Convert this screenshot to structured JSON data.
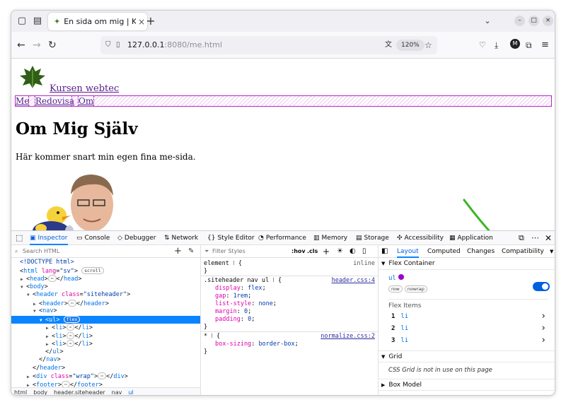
{
  "browser": {
    "tab_title": "En sida om mig | Kursen w",
    "url_host": "127.0.0.1",
    "url_rest": ":8080/me.html",
    "zoom": "120%"
  },
  "page": {
    "site_link": "Kursen webtec",
    "nav": [
      "Me",
      "Redovisa",
      "Om"
    ],
    "heading": "Om Mig Själv",
    "paragraph": "Här kommer snart min egen fina me-sida."
  },
  "devtools": {
    "tabs": [
      "Inspector",
      "Console",
      "Debugger",
      "Network",
      "Style Editor",
      "Performance",
      "Memory",
      "Storage",
      "Accessibility",
      "Application"
    ],
    "markup": {
      "search_placeholder": "Search HTML",
      "lines": [
        {
          "indent": 0,
          "html": "<span class='val'>&lt;!DOCTYPE html&gt;</span>"
        },
        {
          "indent": 0,
          "html": "&lt;<span class='tag'>html</span> <span class='att'>lang</span>=<span class='val'>\"sv\"</span>&gt; <span class='badge'>scroll</span>"
        },
        {
          "indent": 1,
          "tri": "▶",
          "html": "&lt;<span class='tag'>head</span>&gt;<span class='badge'>⋯</span>&lt;/<span class='tag'>head</span>&gt;"
        },
        {
          "indent": 1,
          "tri": "▼",
          "html": "&lt;<span class='tag'>body</span>&gt;"
        },
        {
          "indent": 2,
          "tri": "▼",
          "html": "&lt;<span class='tag'>header</span> <span class='att'>class</span>=<span class='val'>\"siteheader\"</span>&gt;"
        },
        {
          "indent": 3,
          "tri": "▶",
          "html": "&lt;<span class='tag'>header</span>&gt;<span class='badge'>⋯</span>&lt;/<span class='tag'>header</span>&gt;"
        },
        {
          "indent": 3,
          "tri": "▼",
          "html": "&lt;<span class='tag'>nav</span>&gt;"
        },
        {
          "indent": 4,
          "tri": "▼",
          "sel": true,
          "html": "&lt;<span class='tag'>ul</span>&gt; <span class='badge'>flex</span>"
        },
        {
          "indent": 5,
          "tri": "▶",
          "html": "&lt;<span class='tag'>li</span>&gt;<span class='badge'>⋯</span>&lt;/<span class='tag'>li</span>&gt;"
        },
        {
          "indent": 5,
          "tri": "▶",
          "html": "&lt;<span class='tag'>li</span>&gt;<span class='badge'>⋯</span>&lt;/<span class='tag'>li</span>&gt;"
        },
        {
          "indent": 5,
          "tri": "▶",
          "html": "&lt;<span class='tag'>li</span>&gt;<span class='badge'>⋯</span>&lt;/<span class='tag'>li</span>&gt;"
        },
        {
          "indent": 4,
          "html": "&lt;/<span class='tag'>ul</span>&gt;"
        },
        {
          "indent": 3,
          "html": "&lt;/<span class='tag'>nav</span>&gt;"
        },
        {
          "indent": 2,
          "html": "&lt;/<span class='tag'>header</span>&gt;"
        },
        {
          "indent": 2,
          "tri": "▶",
          "html": "&lt;<span class='tag'>div</span> <span class='att'>class</span>=<span class='val'>\"wrap\"</span>&gt;<span class='badge'>⋯</span>&lt;/<span class='tag'>div</span>&gt;"
        },
        {
          "indent": 2,
          "tri": "▶",
          "html": "&lt;<span class='tag'>footer</span>&gt;<span class='badge'>⋯</span>&lt;/<span class='tag'>footer</span>&gt;"
        }
      ],
      "breadcrumbs": [
        "html",
        "body",
        "header.siteheader",
        "nav",
        "ul"
      ]
    },
    "rules": {
      "filter_placeholder": "Filter Styles",
      "hov": ":hov",
      "cls": ".cls",
      "blocks": [
        {
          "selector": "element ⁝ {",
          "source": "inline",
          "props": []
        },
        {
          "selector": ".siteheader nav ul ⁝ {",
          "source": "header.css:4",
          "props": [
            [
              "display",
              "flex"
            ],
            [
              "gap",
              "1rem"
            ],
            [
              "list-style",
              "none"
            ],
            [
              "margin",
              "0"
            ],
            [
              "padding",
              "0"
            ]
          ]
        },
        {
          "selector": "* ⁝ {",
          "source": "normalize.css:2",
          "props": [
            [
              "box-sizing",
              "border-box"
            ]
          ]
        }
      ]
    },
    "layout": {
      "tabs": [
        "Layout",
        "Computed",
        "Changes",
        "Compatibility"
      ],
      "flex_container": "Flex Container",
      "ul_label": "ul",
      "badges": [
        "row",
        "nowrap"
      ],
      "flex_items": "Flex Items",
      "items": [
        {
          "n": "1",
          "tag": "li"
        },
        {
          "n": "2",
          "tag": "li"
        },
        {
          "n": "3",
          "tag": "li"
        }
      ],
      "grid": "Grid",
      "grid_msg": "CSS Grid is not in use on this page",
      "box_model": "Box Model"
    }
  },
  "colors": {
    "accent": "#0060df",
    "arrow": "#3cb521",
    "flex_outline": "#b02bc4"
  }
}
